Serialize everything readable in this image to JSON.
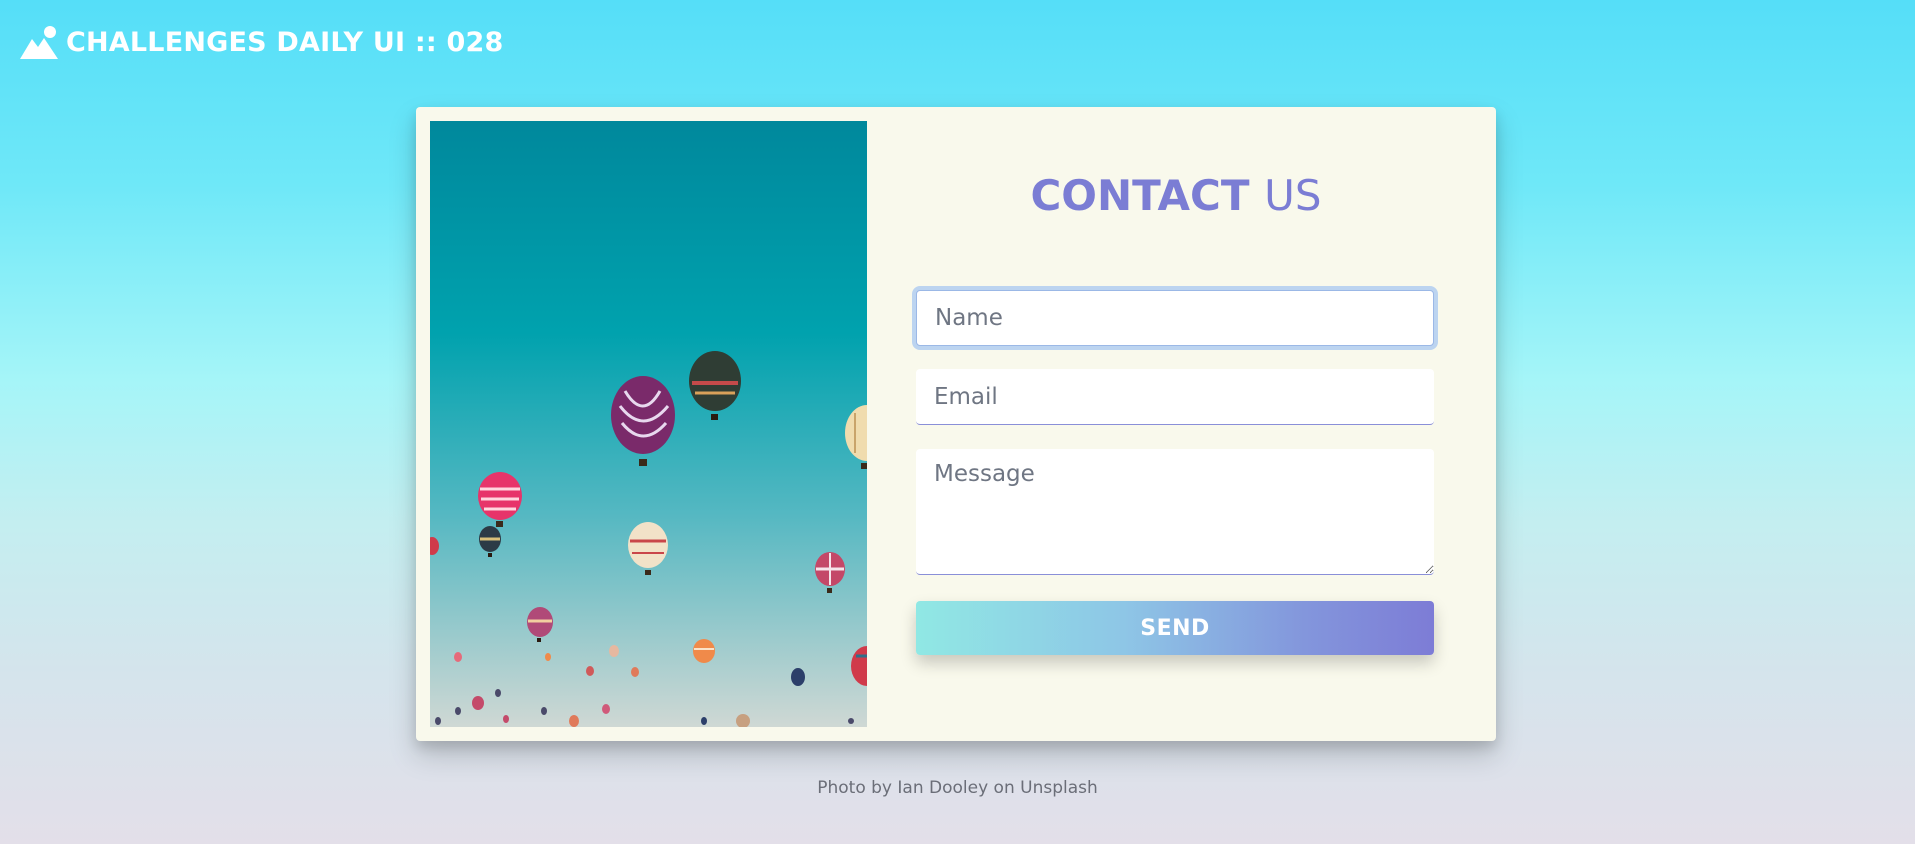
{
  "header": {
    "logo_icon": "mountain-icon",
    "title": "CHALLENGES DAILY UI :: 028"
  },
  "photo": {
    "alt": "hot-air-balloons-photo"
  },
  "contact": {
    "heading_bold": "CONTACT",
    "heading_light": "US",
    "name_placeholder": "Name",
    "email_placeholder": "Email",
    "message_placeholder": "Message",
    "send_label": "SEND"
  },
  "credit": {
    "text_prefix": "Photo by ",
    "photographer": "Ian Dooley",
    "text_middle": " on ",
    "source": "Unsplash"
  },
  "colors": {
    "accent": "#7b7dd4",
    "card_bg": "#f9f9ec",
    "sky_top": "#00889c",
    "button_start": "#90e8e4",
    "button_end": "#7d7cd6"
  }
}
